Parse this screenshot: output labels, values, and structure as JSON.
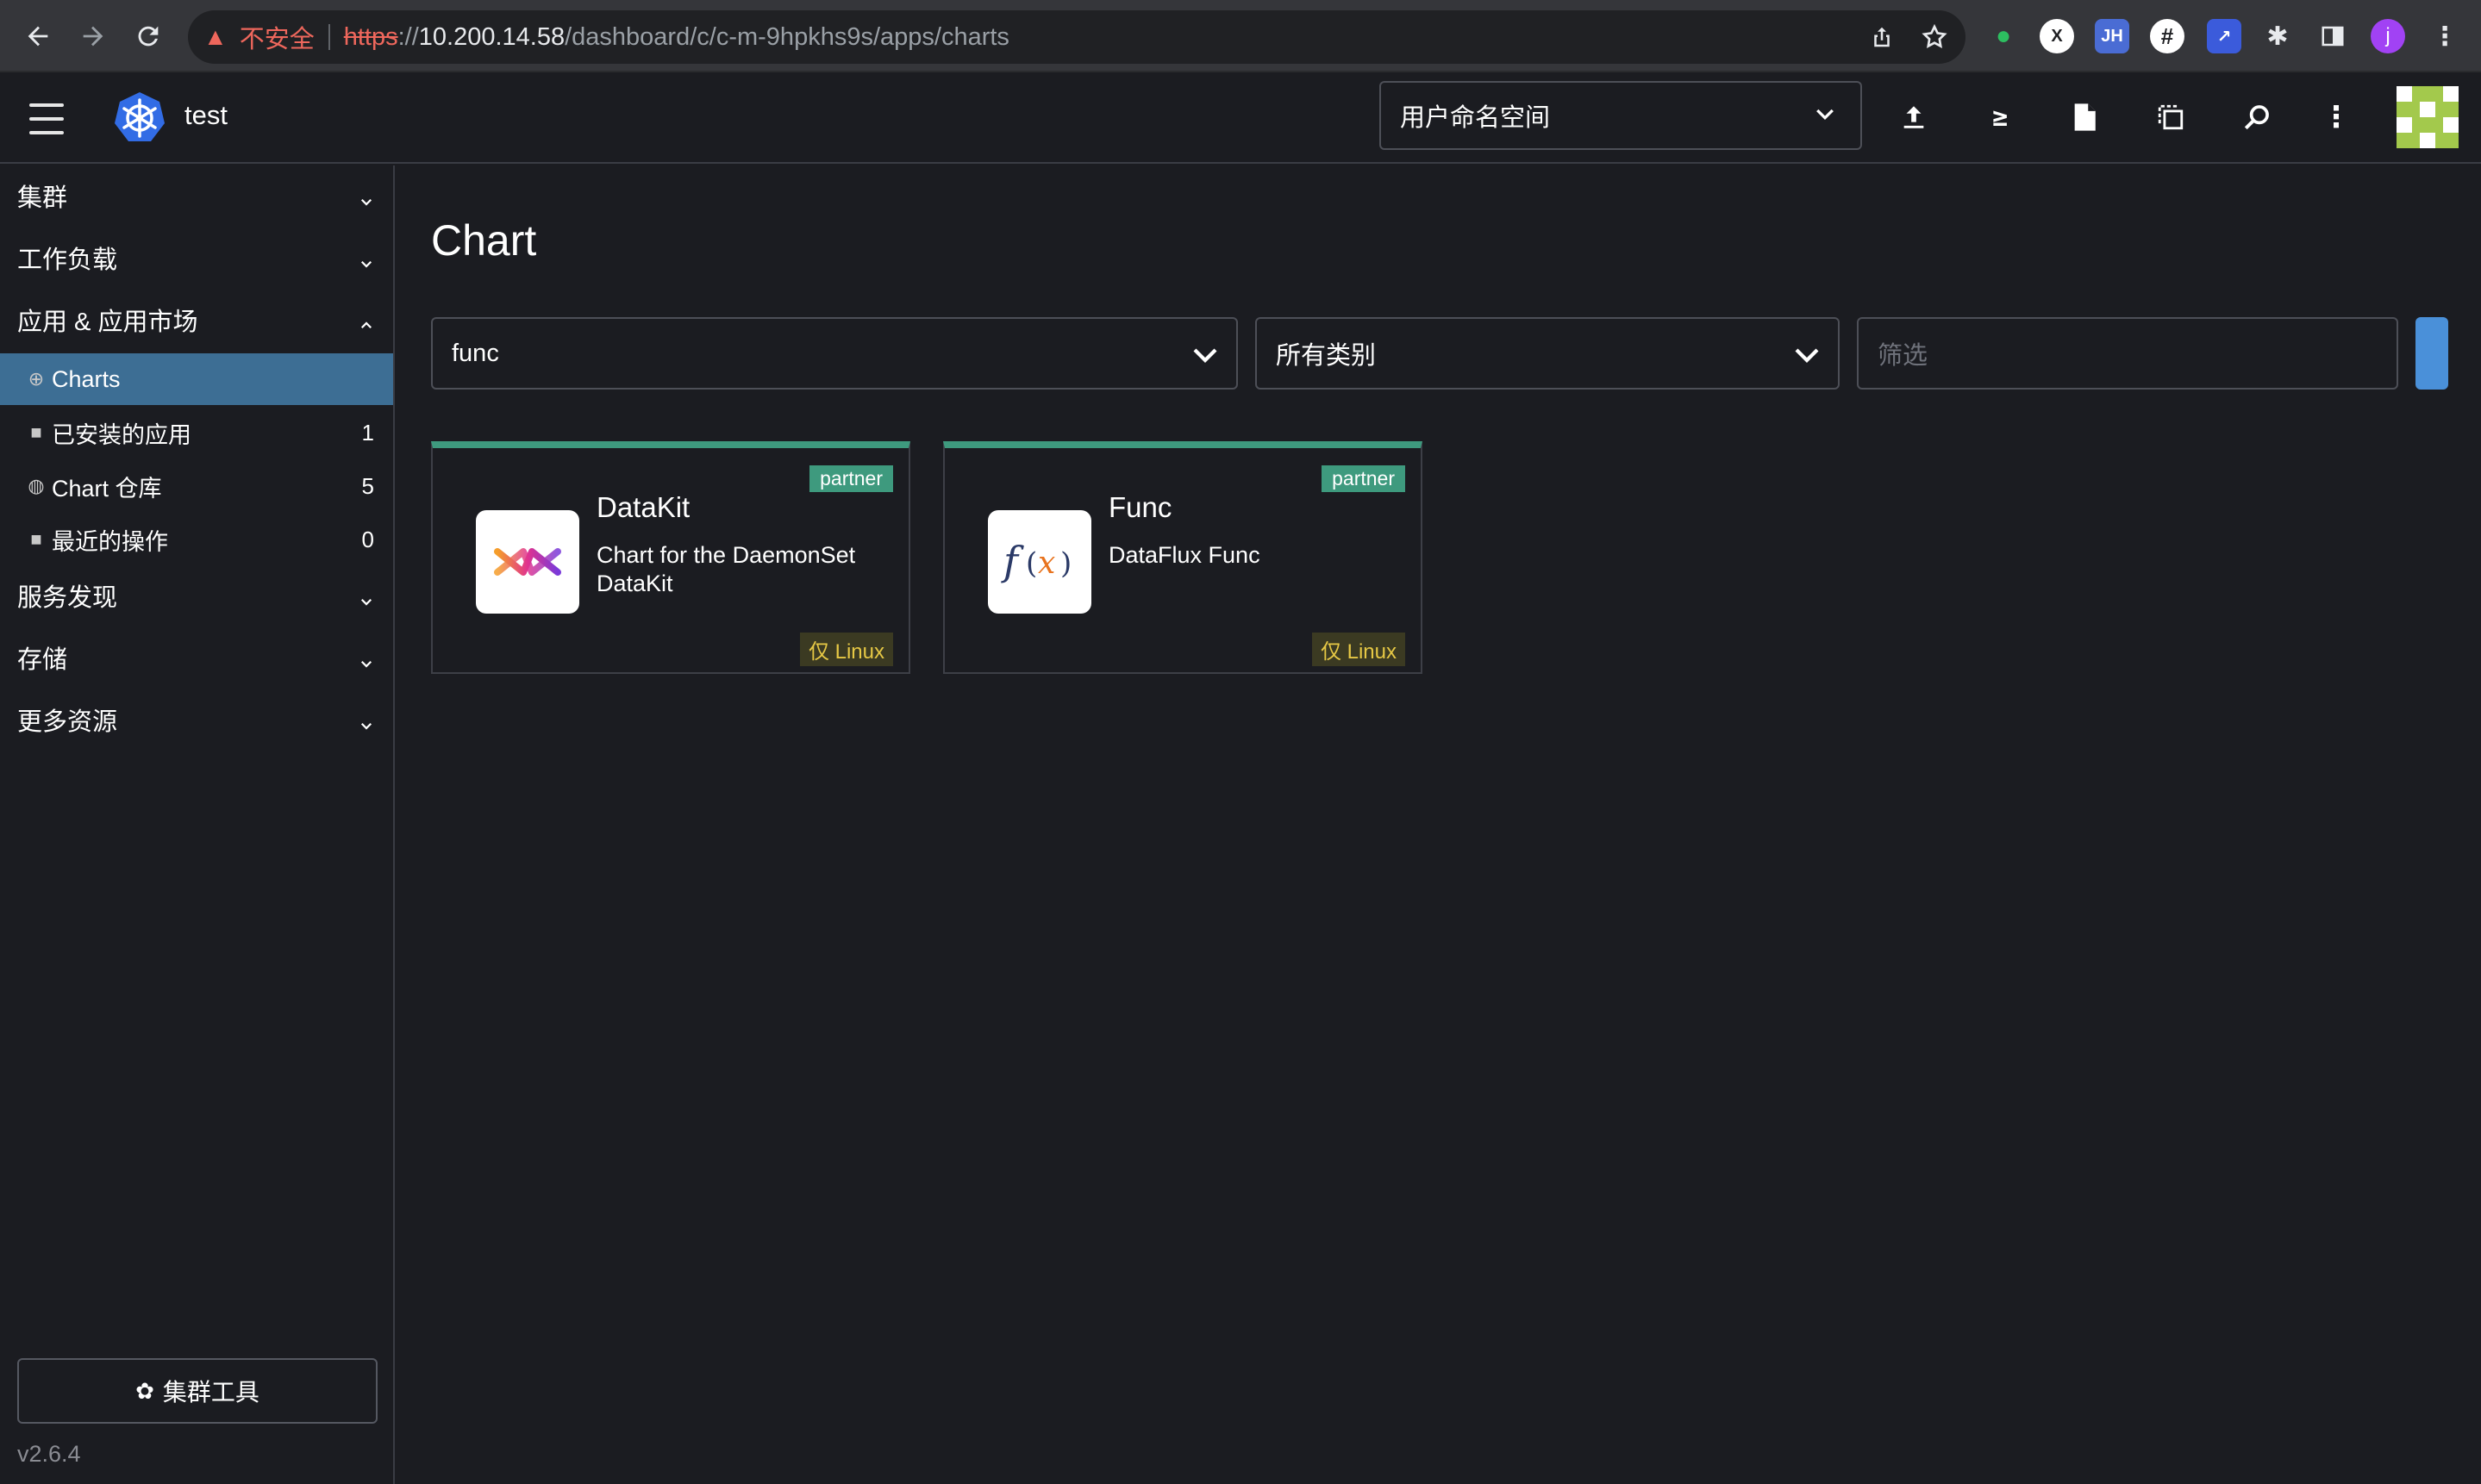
{
  "browser": {
    "security_label": "不安全",
    "url_scheme": "https",
    "url_sep": "://",
    "url_host": "10.200.14.58",
    "url_path": "/dashboard/c/c-m-9hpkhs9s/apps/charts",
    "profile_initial": "j"
  },
  "header": {
    "cluster_name": "test",
    "namespace_select": "用户命名空间"
  },
  "sidebar": {
    "groups": [
      {
        "label": "集群"
      },
      {
        "label": "工作负载"
      },
      {
        "label": "应用 & 应用市场"
      },
      {
        "label": "服务发现"
      },
      {
        "label": "存储"
      },
      {
        "label": "更多资源"
      }
    ],
    "items": [
      {
        "label": "Charts",
        "count": ""
      },
      {
        "label": "已安装的应用",
        "count": "1"
      },
      {
        "label": "Chart 仓库",
        "count": "5"
      },
      {
        "label": "最近的操作",
        "count": "0"
      }
    ],
    "cluster_tools": "集群工具",
    "version": "v2.6.4"
  },
  "main": {
    "title": "Chart",
    "repo_filter": "func",
    "category_filter": "所有类别",
    "search_placeholder": "筛选",
    "cards": [
      {
        "name": "DataKit",
        "badge": "partner",
        "description": "Chart for the DaemonSet DataKit",
        "os": "仅 Linux"
      },
      {
        "name": "Func",
        "badge": "partner",
        "description": "DataFlux Func",
        "os": "仅 Linux"
      }
    ]
  },
  "colors": {
    "accent_active": "#3d6e94",
    "partner_badge": "#3e9a7e",
    "primary_button": "#4a90d9",
    "linux_badge_text": "#e6c845"
  }
}
